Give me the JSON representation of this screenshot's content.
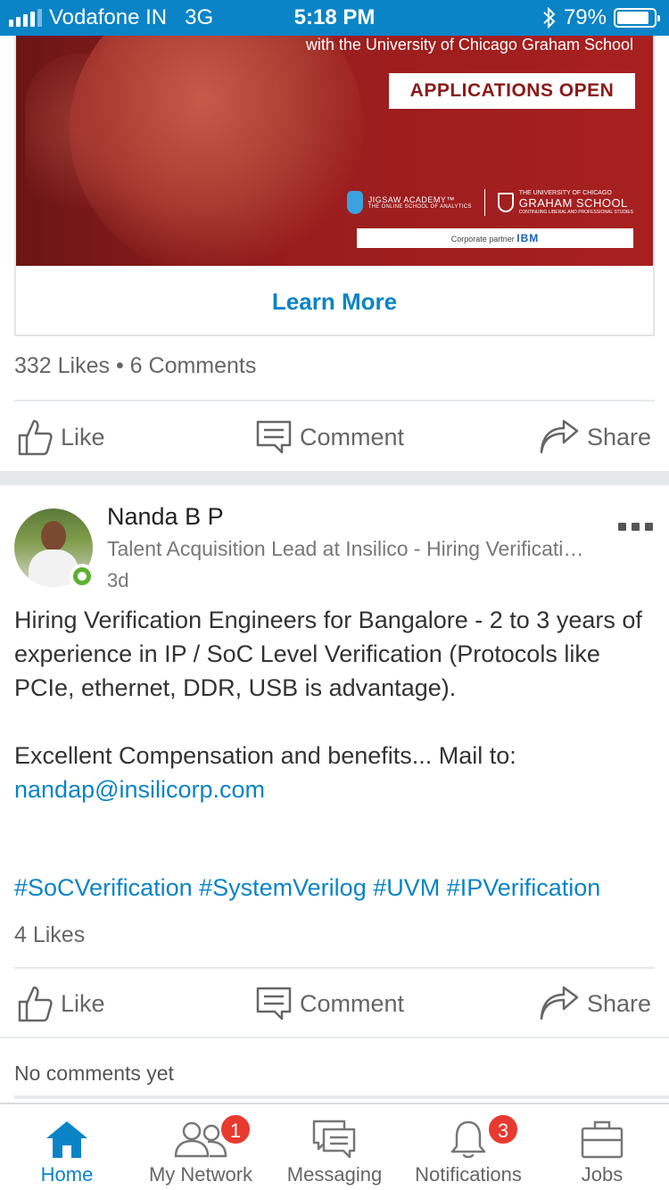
{
  "status_bar": {
    "carrier": "Vodafone IN",
    "network": "3G",
    "time": "5:18 PM",
    "battery": "79%",
    "battery_level": 0.79
  },
  "ad": {
    "tagline": "with the University of Chicago Graham School",
    "badge": "APPLICATIONS OPEN",
    "jigsaw_name": "JIGSAW ACADEMY™",
    "jigsaw_sub": "THE ONLINE SCHOOL OF ANALYTICS",
    "uchicago_line1": "THE UNIVERSITY OF CHICAGO",
    "uchicago_line2": "GRAHAM SCHOOL",
    "uchicago_line3": "CONTINUING LIBERAL AND PROFESSIONAL STUDIES",
    "partner_label": "Corporate partner",
    "partner_name": "IBM",
    "cta": "Learn More"
  },
  "post1": {
    "counts": "332 Likes • 6 Comments"
  },
  "actions": {
    "like": "Like",
    "comment": "Comment",
    "share": "Share"
  },
  "post2": {
    "author": "Nanda B P",
    "headline": "Talent Acquisition Lead at Insilico - Hiring Verification Engineers",
    "time": "3d",
    "line1": "Hiring Verification Engineers for Bangalore -  2 to 3 years of experience in IP / SoC Level Verification (Protocols like PCIe, ethernet, DDR, USB is advantage).",
    "line2": "Excellent Compensation and benefits... Mail to:",
    "email": "nandap@insilicorp.com",
    "hashtags": "#SoCVerification #SystemVerilog #UVM #IPVerification",
    "likes": "4 Likes",
    "no_comments": "No comments yet"
  },
  "nav": {
    "home": "Home",
    "network": "My Network",
    "network_badge": "1",
    "messaging": "Messaging",
    "notifications": "Notifications",
    "notifications_badge": "3",
    "jobs": "Jobs"
  },
  "colors": {
    "brand": "#0a84c6",
    "badge": "#e8392f",
    "presence": "#5cb030"
  }
}
